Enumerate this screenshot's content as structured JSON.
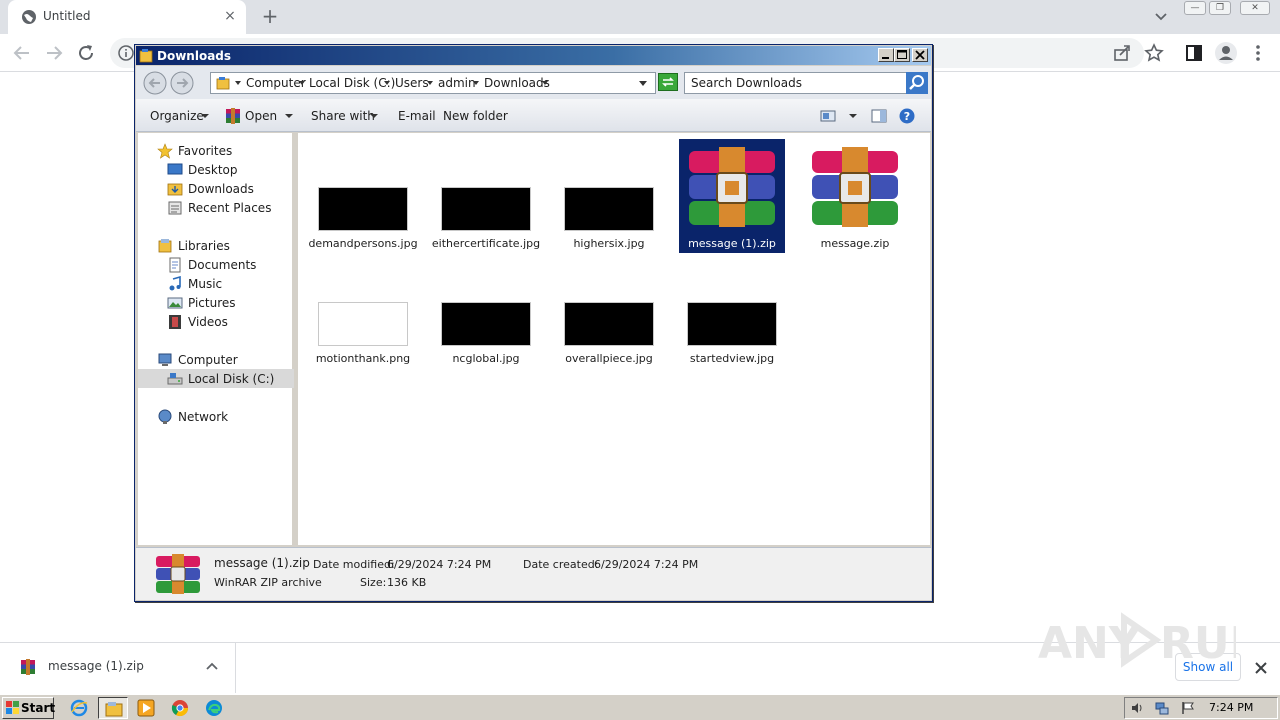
{
  "browser": {
    "tab_title": "Untitled",
    "tab_close": "×",
    "new_tab": "+"
  },
  "explorer": {
    "title": "Downloads",
    "breadcrumbs": [
      "Computer",
      "Local Disk (C:)",
      "Users",
      "admin",
      "Downloads"
    ],
    "search_placeholder": "Search Downloads",
    "commands": {
      "organize": "Organize",
      "open": "Open",
      "share_with": "Share with",
      "email": "E-mail",
      "new_folder": "New folder"
    },
    "nav": {
      "favorites": "Favorites",
      "desktop": "Desktop",
      "downloads": "Downloads",
      "recent_places": "Recent Places",
      "libraries": "Libraries",
      "documents": "Documents",
      "music": "Music",
      "pictures": "Pictures",
      "videos": "Videos",
      "computer": "Computer",
      "local_disk": "Local Disk (C:)",
      "network": "Network"
    },
    "files": [
      {
        "name": "demandpersons.jpg",
        "kind": "dark-thumbnail"
      },
      {
        "name": "eithercertificate.jpg",
        "kind": "dark-thumbnail"
      },
      {
        "name": "highersix.jpg",
        "kind": "dark-thumbnail"
      },
      {
        "name": "message (1).zip",
        "kind": "winrar-archive",
        "selected": true
      },
      {
        "name": "message.zip",
        "kind": "winrar-archive"
      },
      {
        "name": "motionthank.png",
        "kind": "light-thumbnail"
      },
      {
        "name": "ncglobal.jpg",
        "kind": "dark-thumbnail"
      },
      {
        "name": "overallpiece.jpg",
        "kind": "dark-thumbnail"
      },
      {
        "name": "startedview.jpg",
        "kind": "dark-thumbnail"
      }
    ],
    "details": {
      "name": "message (1).zip",
      "type": "WinRAR ZIP archive",
      "date_modified_label": "Date modified:",
      "date_modified": "6/29/2024 7:24 PM",
      "date_created_label": "Date created:",
      "date_created": "6/29/2024 7:24 PM",
      "size_label": "Size:",
      "size": "136 KB"
    }
  },
  "download_shelf": {
    "item_name": "message (1).zip",
    "show_all": "Show all"
  },
  "taskbar": {
    "start": "Start",
    "clock": "7:24 PM"
  },
  "colors": {
    "explorer_title_start": "#0a246a",
    "selection": "#0a246a",
    "link_blue": "#1a73e8"
  }
}
